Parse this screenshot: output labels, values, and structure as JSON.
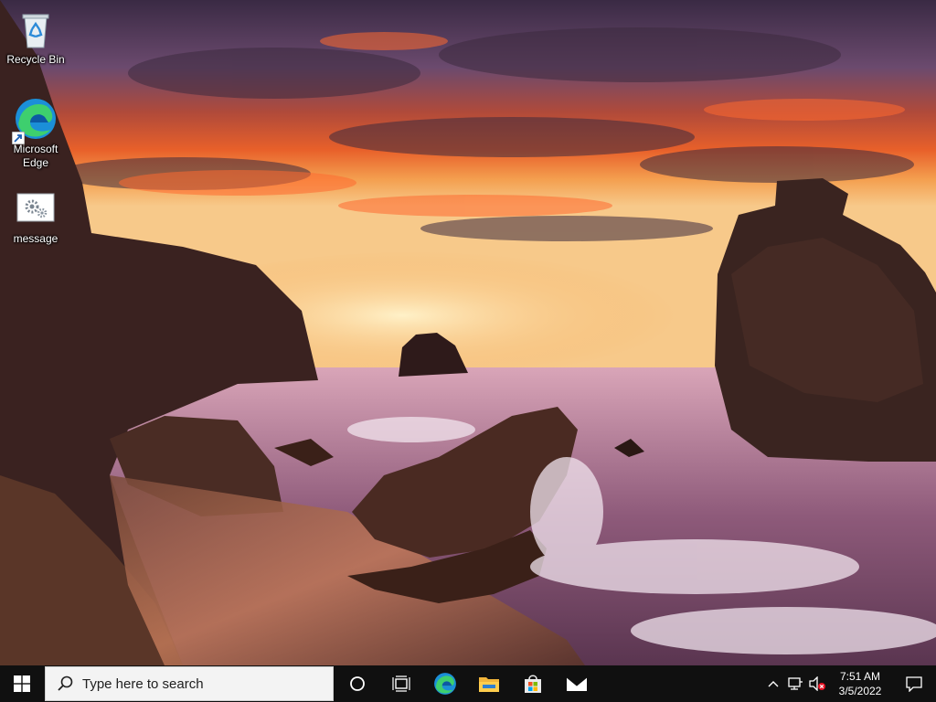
{
  "desktop": {
    "icons": [
      {
        "label": "Recycle Bin",
        "icon": "recycle-bin-icon"
      },
      {
        "label": "Microsoft Edge",
        "icon": "edge-icon"
      },
      {
        "label": "message",
        "icon": "settings-app-icon"
      }
    ],
    "wallpaper": "sunset-beach-rocks"
  },
  "taskbar": {
    "start_icon": "windows-logo-icon",
    "search": {
      "placeholder": "Type here to search",
      "icon": "search-icon"
    },
    "pinned": [
      {
        "name": "cortana",
        "icon": "circle-icon"
      },
      {
        "name": "task-view",
        "icon": "task-view-icon"
      },
      {
        "name": "edge",
        "icon": "edge-icon"
      },
      {
        "name": "file-explorer",
        "icon": "folder-icon"
      },
      {
        "name": "store",
        "icon": "store-icon"
      },
      {
        "name": "mail",
        "icon": "mail-icon"
      }
    ],
    "tray": {
      "icons": [
        "chevron-up-icon",
        "network-icon",
        "speaker-muted-icon"
      ],
      "time": "7:51 AM",
      "date": "3/5/2022",
      "notification_icon": "action-center-icon"
    },
    "colors": {
      "background": "#101010",
      "search_bg": "#f3f3f3"
    }
  }
}
